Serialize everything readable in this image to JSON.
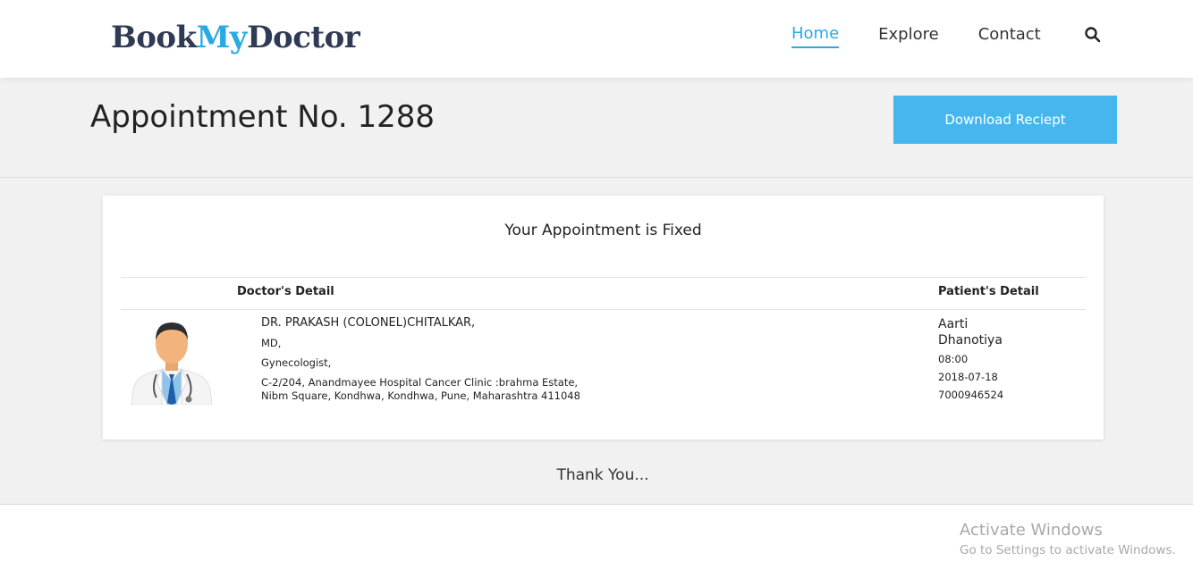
{
  "header": {
    "logo_part1": "Book",
    "logo_part2": "My",
    "logo_part3": "Doctor",
    "nav": [
      "Home",
      "Explore",
      "Contact"
    ],
    "search_icon": "search-icon"
  },
  "page": {
    "title": "Appointment No. 1288",
    "download_label": "Download Reciept"
  },
  "card": {
    "title": "Your Appointment is Fixed",
    "doctor_header": "Doctor's Detail",
    "patient_header": "Patient's Detail",
    "doctor": {
      "name": "DR. PRAKASH (COLONEL)CHITALKAR,",
      "degree": "MD,",
      "specialty": "Gynecologist,",
      "address_line1": "C-2/204, Anandmayee Hospital Cancer Clinic :brahma Estate,",
      "address_line2": "Nibm Square, Kondhwa, Kondhwa, Pune, Maharashtra 411048"
    },
    "patient": {
      "name": "Aarti Dhanotiya",
      "time": "08:00",
      "date": "2018-07-18",
      "phone": "7000946524"
    }
  },
  "footer": {
    "thanks": "Thank You..."
  },
  "watermark": {
    "title": "Activate Windows",
    "subtitle": "Go to Settings to activate Windows."
  },
  "colors": {
    "accent": "#2aaae2",
    "button": "#45b7ee",
    "logo_dark": "#2f3b55"
  }
}
